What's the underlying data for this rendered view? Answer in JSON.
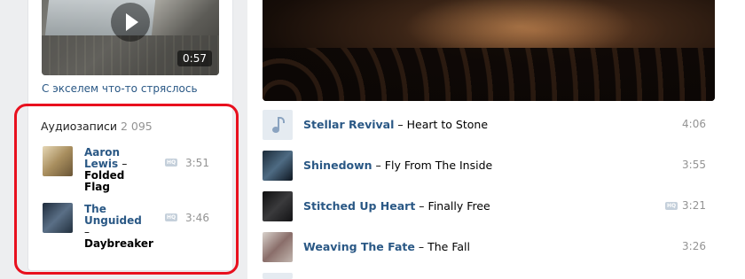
{
  "left": {
    "video": {
      "duration": "0:57",
      "caption": "С экселем что-то стряслось"
    },
    "audio": {
      "header": "Аудиозаписи",
      "count": "2 095",
      "tracks": [
        {
          "artist": "Aaron Lewis",
          "dash": "–",
          "title": "Folded Flag",
          "hq": "HQ",
          "duration": "3:51"
        },
        {
          "artist": "The Unguided",
          "dash": "–",
          "title": "Daybreaker",
          "hq": "HQ",
          "duration": "3:46"
        }
      ]
    }
  },
  "right": {
    "tracks": [
      {
        "artist": "Stellar Revival",
        "title": "Heart to Stone",
        "duration": "4:06",
        "cover": "music-note-icon"
      },
      {
        "artist": "Shinedown",
        "title": "Fly From The Inside",
        "duration": "3:55",
        "cover": "album-cover"
      },
      {
        "artist": "Stitched Up Heart",
        "title": "Finally Free",
        "duration": "3:21",
        "hq": "HQ",
        "cover": "album-cover"
      },
      {
        "artist": "Weaving The Fate",
        "title": "The Fall",
        "duration": "3:26",
        "cover": "album-cover"
      }
    ],
    "dash": "–"
  },
  "colors": {
    "link": "#2a5885",
    "muted": "#939393",
    "highlight": "#e8101e",
    "page_bg": "#edeef0"
  }
}
